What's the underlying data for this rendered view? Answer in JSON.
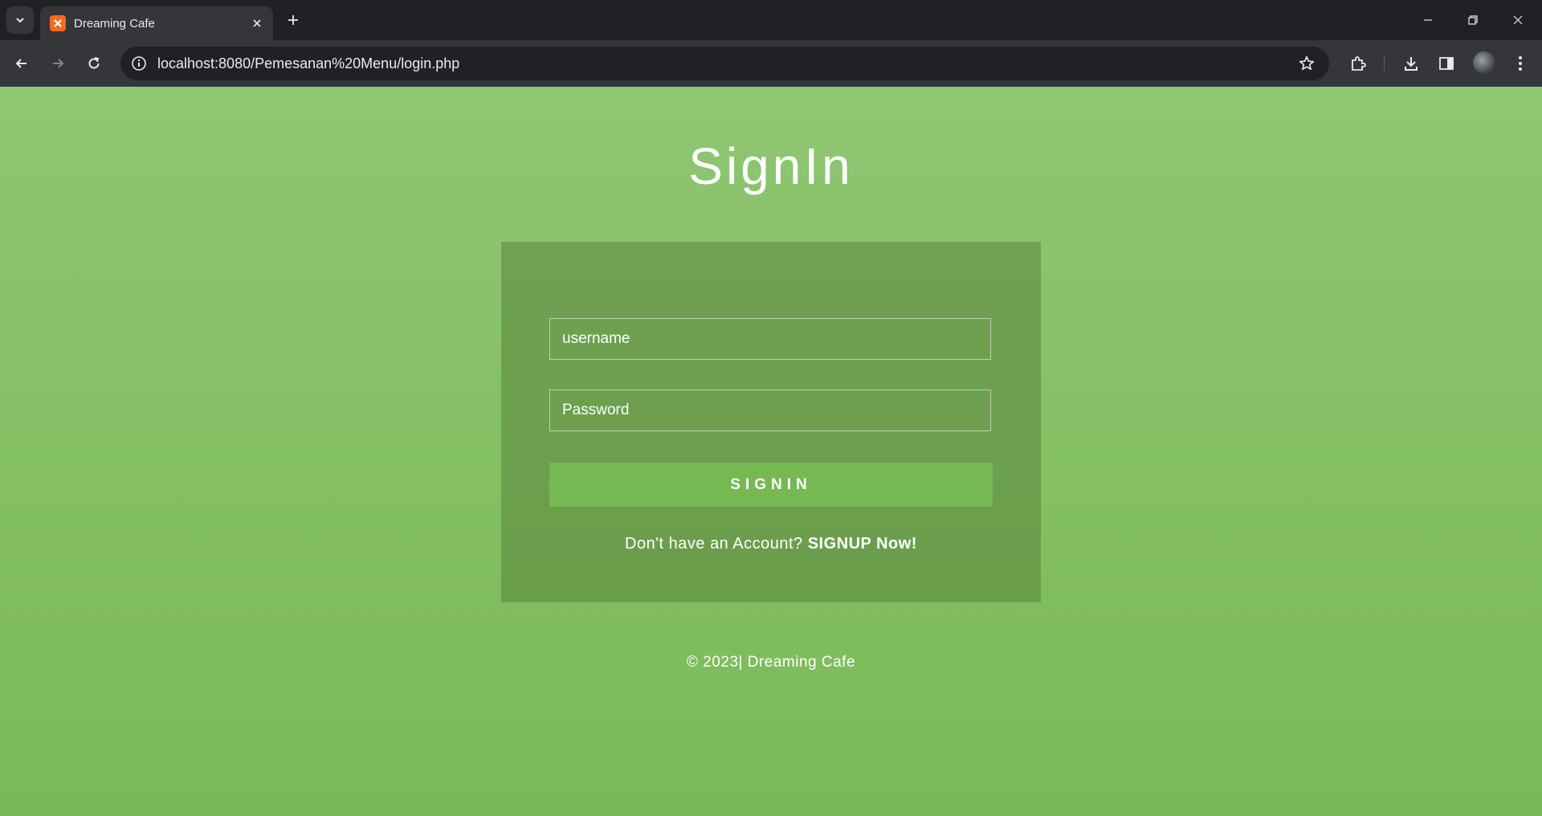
{
  "browser": {
    "tab": {
      "title": "Dreaming Cafe",
      "favicon": "xampp-icon"
    },
    "address_bar": {
      "url": "localhost:8080/Pemesanan%20Menu/login.php"
    },
    "colors": {
      "chrome_dark": "#202124",
      "chrome_toolbar": "#35363a",
      "favicon": "#f26b21"
    }
  },
  "page": {
    "title": "SignIn",
    "form": {
      "username_placeholder": "username",
      "password_placeholder": "Password",
      "signin_label": "SIGNIN",
      "signup_prompt": "Don't have an Account?",
      "signup_link": "SIGNUP Now!"
    },
    "footer": "© 2023| Dreaming Cafe",
    "colors": {
      "background_top": "#8fc672",
      "background_bottom": "#7ab957",
      "button": "#76b952"
    }
  }
}
